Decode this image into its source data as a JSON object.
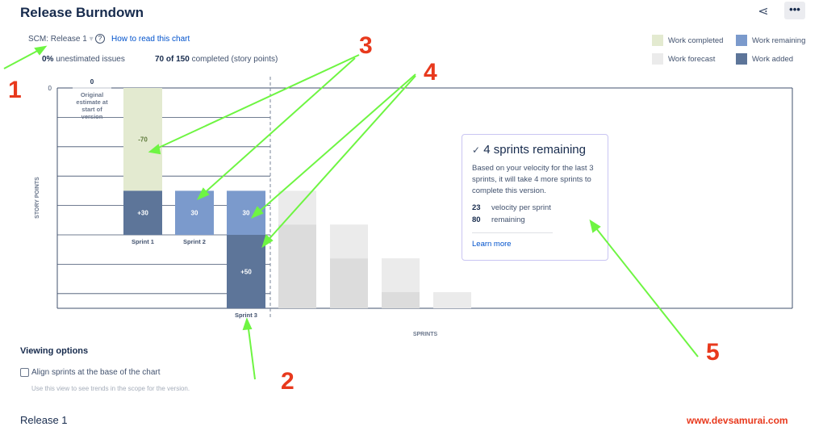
{
  "header": {
    "title": "Release Burndown",
    "share_icon": "share-icon",
    "more_label": "•••"
  },
  "controls": {
    "version_select": "SCM: Release 1",
    "help_link": "How to read this chart"
  },
  "summary": {
    "unestimated_value": "0%",
    "unestimated_label": "unestimated issues",
    "completed_value": "70 of 150",
    "completed_label": "completed (story points)"
  },
  "legend": [
    {
      "label": "Work completed",
      "color": "#e3ead0"
    },
    {
      "label": "Work remaining",
      "color": "#7b9acc"
    },
    {
      "label": "Work forecast",
      "color": "#ebebeb"
    },
    {
      "label": "Work added",
      "color": "#5d7599"
    }
  ],
  "chart_data": {
    "type": "bar",
    "stacked": true,
    "ylabel": "STORY POINTS",
    "xlabel": "SPRINTS",
    "ylim": [
      0,
      150
    ],
    "y_inverted": true,
    "y_tick_labels": [
      "0"
    ],
    "grid": true,
    "original": {
      "value_label": "0",
      "label": "Original estimate at start of version"
    },
    "sprints": [
      {
        "name": "Sprint 1",
        "completed": 70,
        "completed_label": "-70",
        "remaining": 0,
        "added": 30,
        "added_label": "+30"
      },
      {
        "name": "Sprint 2",
        "completed": 0,
        "remaining": 30,
        "remaining_label": "30",
        "added": 0
      },
      {
        "name": "Sprint 3",
        "completed": 0,
        "remaining": 30,
        "remaining_label": "30",
        "added": 50,
        "added_label": "+50"
      }
    ],
    "forecast": [
      {
        "forecast": 23,
        "remaining": 57
      },
      {
        "forecast": 23,
        "remaining": 34
      },
      {
        "forecast": 23,
        "remaining": 11
      },
      {
        "forecast": 11,
        "remaining": 0
      }
    ]
  },
  "card": {
    "title": "4 sprints remaining",
    "body": "Based on your velocity for the last 3 sprints, it will take 4 more sprints to complete this version.",
    "velocity_value": "23",
    "velocity_label": "velocity per sprint",
    "remaining_value": "80",
    "remaining_label": "remaining",
    "link": "Learn more"
  },
  "viewing": {
    "heading": "Viewing options",
    "checkbox_label": "Align sprints at the base of the chart",
    "checkbox_checked": false,
    "hint": "Use this view to see trends in the scope for the version."
  },
  "release": {
    "heading": "Release 1"
  },
  "annotations": [
    "1",
    "2",
    "3",
    "4",
    "5"
  ],
  "watermark": "www.devsamurai.com"
}
